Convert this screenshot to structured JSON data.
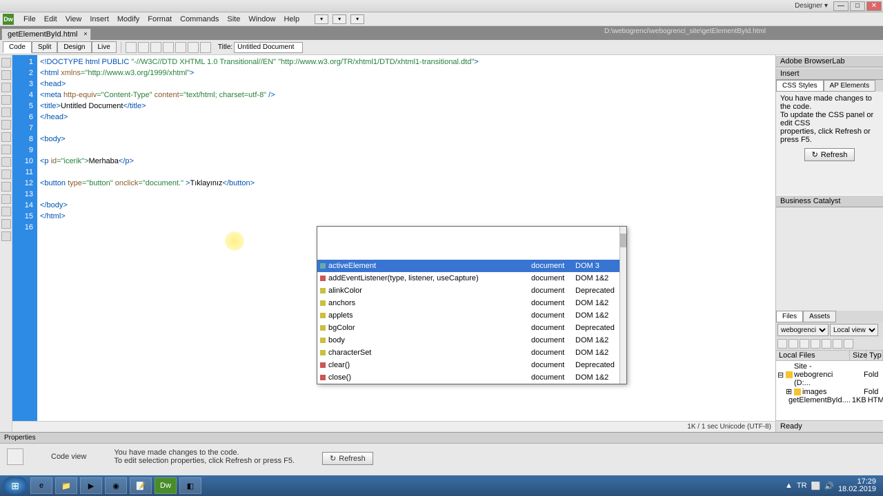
{
  "window": {
    "user": "Designer ▾"
  },
  "menu": [
    "File",
    "Edit",
    "View",
    "Insert",
    "Modify",
    "Format",
    "Commands",
    "Site",
    "Window",
    "Help"
  ],
  "file_tab": {
    "name": "getElementById.html",
    "path": "D:\\webogrenci\\webogrenci_site\\getElementById.html"
  },
  "viewbar": {
    "views": [
      "Code",
      "Split",
      "Design",
      "Live"
    ],
    "active": "Code",
    "title_label": "Title:",
    "title_value": "Untitled Document"
  },
  "code": {
    "lines": [
      1,
      2,
      3,
      4,
      5,
      6,
      7,
      8,
      9,
      10,
      11,
      12,
      13,
      14,
      15,
      16
    ],
    "l1a": "<!DOCTYPE html PUBLIC ",
    "l1b": "\"-//W3C//DTD XHTML 1.0 Transitional//EN\" \"http://www.w3.org/TR/xhtml1/DTD/xhtml1-transitional.dtd\"",
    "l1c": ">",
    "l2a": "<html ",
    "l2b": "xmlns",
    "l2c": "=\"http://www.w3.org/1999/xhtml\"",
    "l2d": ">",
    "l3": "<head>",
    "l4a": "<meta ",
    "l4b": "http-equiv",
    "l4c": "=\"Content-Type\" ",
    "l4d": "content",
    "l4e": "=\"text/html; charset=utf-8\" ",
    "l4f": "/>",
    "l5a": "<title>",
    "l5b": "Untitled Document",
    "l5c": "</title>",
    "l6": "</head>",
    "l7": "",
    "l8": "<body>",
    "l9": "",
    "l10a": "<p ",
    "l10b": "id",
    "l10c": "=\"icerik\">",
    "l10d": "Merhaba",
    "l10e": "</p>",
    "l11": "",
    "l12a": "<button ",
    "l12b": "type",
    "l12c": "=\"button\" ",
    "l12d": "onclick",
    "l12e": "=\"document.\" ",
    "l12f": ">",
    "l12g": "Tıklayınız",
    "l12h": "</button>",
    "l13": "",
    "l14": "</body>",
    "l15": "</html>",
    "l16": ""
  },
  "autocomplete": {
    "items": [
      {
        "name": "activeElement",
        "c2": "document",
        "c3": "DOM 3",
        "sel": true,
        "ico": "#6aa"
      },
      {
        "name": "addEventListener(type, listener, useCapture)",
        "c2": "document",
        "c3": "DOM 1&2",
        "ico": "#c55"
      },
      {
        "name": "alinkColor",
        "c2": "document",
        "c3": "Deprecated",
        "ico": "#c9c040"
      },
      {
        "name": "anchors",
        "c2": "document",
        "c3": "DOM 1&2",
        "ico": "#c9c040"
      },
      {
        "name": "applets",
        "c2": "document",
        "c3": "DOM 1&2",
        "ico": "#c9c040"
      },
      {
        "name": "bgColor",
        "c2": "document",
        "c3": "Deprecated",
        "ico": "#c9c040"
      },
      {
        "name": "body",
        "c2": "document",
        "c3": "DOM 1&2",
        "ico": "#c9c040"
      },
      {
        "name": "characterSet",
        "c2": "document",
        "c3": "DOM 1&2",
        "ico": "#c9c040"
      },
      {
        "name": "clear()",
        "c2": "document",
        "c3": "Deprecated",
        "ico": "#c55"
      },
      {
        "name": "close()",
        "c2": "document",
        "c3": "DOM 1&2",
        "ico": "#c55"
      }
    ]
  },
  "status_strip": "1K / 1 sec   Unicode (UTF-8)",
  "right": {
    "p1": "Adobe BrowserLab",
    "p2": "Insert",
    "css_tabs": [
      "CSS Styles",
      "AP Elements"
    ],
    "css_active": "CSS Styles",
    "css_msg1": "You have made changes to the code.",
    "css_msg2": "To update the CSS panel or edit CSS",
    "css_msg3": "properties, click Refresh or press F5.",
    "refresh": "Refresh",
    "p_bc": "Business Catalyst",
    "files_tabs": [
      "Files",
      "Assets"
    ],
    "files_active": "Files",
    "site_sel": "webogrenci",
    "view_sel": "Local view",
    "cols": {
      "a": "Local Files",
      "b": "Size",
      "c": "Typ"
    },
    "tree": [
      {
        "ind": 0,
        "exp": "⊟",
        "ico": "folder",
        "label": "Site - webogrenci (D:...",
        "t": "Fold"
      },
      {
        "ind": 1,
        "exp": "⊞",
        "ico": "folder",
        "label": "images",
        "t": "Fold"
      },
      {
        "ind": 1,
        "exp": "",
        "ico": "file",
        "label": "getElementById....",
        "s": "1KB",
        "t": "HTM"
      }
    ],
    "ready": "Ready"
  },
  "props": {
    "title": "Properties",
    "mode": "Code view",
    "msg1": "You have made changes to the code.",
    "msg2": "To edit selection properties, click Refresh or press F5.",
    "refresh": "Refresh"
  },
  "taskbar": {
    "lang": "TR",
    "time": "17:29",
    "date": "18.02.2019"
  }
}
